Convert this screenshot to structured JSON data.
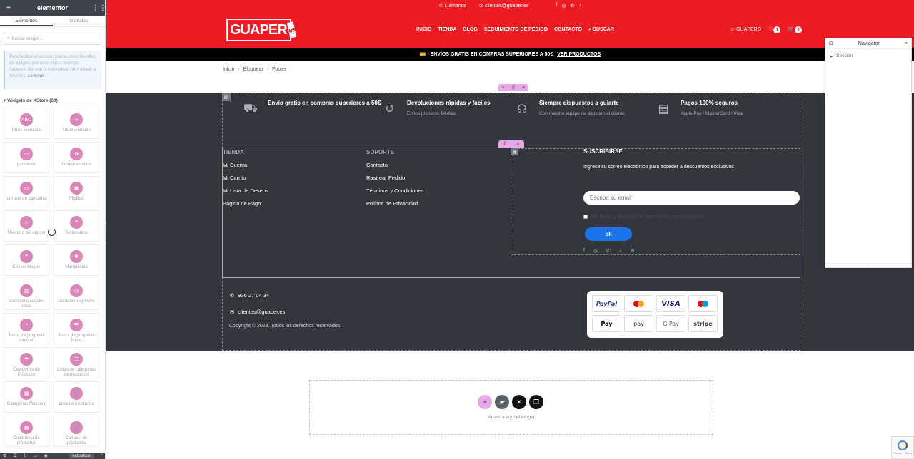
{
  "editor": {
    "logo": "elementor",
    "tabs": [
      "Elementos",
      "Globales"
    ],
    "search_placeholder": "Buscar widget...",
    "tip_text": "Para facilitar el acceso, marca como favoritos los widgets que usas más a menudo haciendo clic con el botón derecho > Añadir a favoritos.",
    "tip_link": "Lo tengo",
    "category": "Widgets de XStore (60)",
    "widgets": [
      {
        "label": "Título avanzado",
        "icon": "abc-icon",
        "glyph": "ABC"
      },
      {
        "label": "Título animado",
        "icon": "animated-title-icon",
        "glyph": "∞"
      },
      {
        "label": "pancartas",
        "icon": "banner-icon",
        "glyph": "▭"
      },
      {
        "label": "bloque estático",
        "icon": "static-block-icon",
        "glyph": "✿"
      },
      {
        "label": "carrusel de pancartas",
        "icon": "banner-carousel-icon",
        "glyph": "▭"
      },
      {
        "label": "FlipBox",
        "icon": "flipbox-icon",
        "glyph": "▣"
      },
      {
        "label": "Miembro del equipo",
        "icon": "team-member-icon",
        "glyph": "☺"
      },
      {
        "label": "Testimonios",
        "icon": "testimonials-icon",
        "glyph": "❝"
      },
      {
        "label": "Cita en bloque",
        "icon": "blockquote-icon",
        "glyph": "❞"
      },
      {
        "label": "Marquesina",
        "icon": "marquee-icon",
        "glyph": "✺"
      },
      {
        "label": "Carrusel cualquier cosa",
        "icon": "any-carousel-icon",
        "glyph": "▥"
      },
      {
        "label": "Contador regresivo",
        "icon": "countdown-icon",
        "glyph": "◷"
      },
      {
        "label": "Barra de progreso circular",
        "icon": "circle-progress-icon",
        "glyph": "◔"
      },
      {
        "label": "Barra de progreso lineal",
        "icon": "linear-progress-icon",
        "glyph": "☰"
      },
      {
        "label": "Categorías de Producto",
        "icon": "product-categories-icon",
        "glyph": "☂"
      },
      {
        "label": "Listas de categorías de productos",
        "icon": "category-lists-icon",
        "glyph": "☷"
      },
      {
        "label": "Categorías Masonry",
        "icon": "masonry-icon",
        "glyph": "▦"
      },
      {
        "label": "Lista de productos",
        "icon": "product-list-icon",
        "glyph": "🛒"
      },
      {
        "label": "Cuadrícula de productos",
        "icon": "product-grid-icon",
        "glyph": "▦"
      },
      {
        "label": "Carrusel de productos",
        "icon": "product-carousel-icon",
        "glyph": "🛒"
      }
    ],
    "update_label": "Actualizar"
  },
  "site": {
    "topbar": {
      "phone": "Llámanos",
      "email": "clientes@guaper.es"
    },
    "logo": "GUAPER",
    "logo_badge": "es",
    "nav": [
      "INICIO",
      "TIENDA",
      "BLOG",
      "SEGUIMIENTO DE PEDIDO",
      "CONTACTO",
      "BUSCAR"
    ],
    "account": "GUAPERO",
    "wishlist_count": "1",
    "cart_count": "0",
    "promo": "ENVÍOS GRATIS EN COMPRAS SUPERIORES A 50€",
    "promo_link": "VER PRODUCTOS",
    "breadcrumb": [
      "Inicio",
      "Bloquear",
      "Footer"
    ]
  },
  "footer": {
    "features": [
      {
        "title": "Envío gratis en compras superiores a 50€",
        "sub": "",
        "icon": "truck-icon",
        "glyph": "⛟"
      },
      {
        "title": "Devoluciones rápidas y fáciles",
        "sub": "En los primeros 14 días",
        "icon": "return-box-icon",
        "glyph": "↺"
      },
      {
        "title": "Siempre dispuestos a guiarte",
        "sub": "Con nuestro equipo de atención al cliente",
        "icon": "support-headset-icon",
        "glyph": "☊"
      },
      {
        "title": "Pagos 100% seguros",
        "sub": "Apple Pay / MasterCard / Visa",
        "icon": "credit-card-icon",
        "glyph": "▤"
      }
    ],
    "tienda": {
      "heading": "TIENDA",
      "links": [
        "Mi Cuenta",
        "Mi Carrito",
        "Mi Lista de Deseos",
        "Página de Pago"
      ]
    },
    "soporte": {
      "heading": "SOPORTE",
      "links": [
        "Contacto",
        "Rastrear Pedido",
        "Términos y Condiciones",
        "Política de Privacidad"
      ]
    },
    "subscribe": {
      "title": "SUSCRIBIRSE",
      "text": "Ingrese su correo electrónico para acceder a descuentos exclusivos",
      "placeholder": "Escriba su email",
      "terms": "He leído y acepto los términos y condiciones",
      "button": "ok"
    },
    "phone": "936 27 04 34",
    "email": "clientes@guaper.es",
    "copyright": "Copyright © 2023. Todos los derechos reservados.",
    "payments": [
      "PayPal",
      "MasterCard",
      "VISA",
      "Maestro",
      "Pay",
      "pay",
      "G Pay",
      "stripe"
    ]
  },
  "dropzone": {
    "text": "Arrastra aquí el widget"
  },
  "navigator": {
    "title": "Navigator",
    "item": "Sección"
  }
}
